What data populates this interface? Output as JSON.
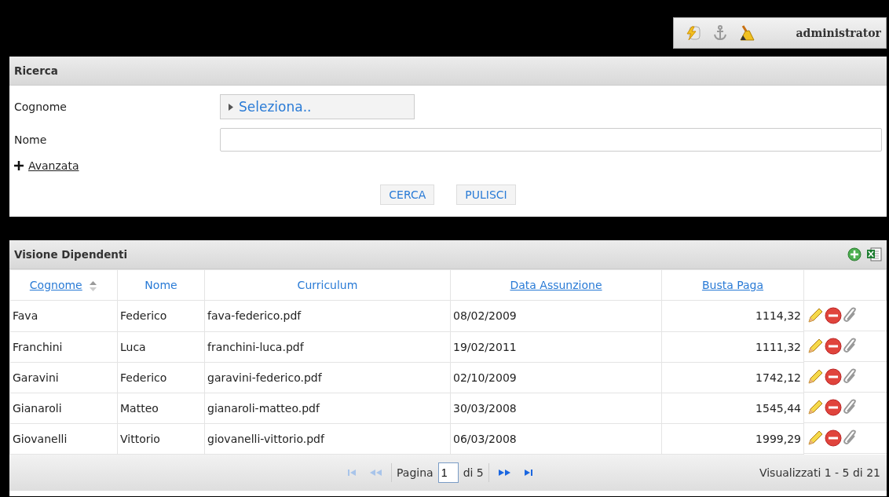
{
  "user_bar": {
    "user": "administrator"
  },
  "search_panel": {
    "title": "Ricerca",
    "fields": [
      {
        "label": "Cognome",
        "kind": "select",
        "value": "Seleziona.."
      },
      {
        "label": "Nome",
        "kind": "text"
      }
    ],
    "advanced_link": "Avanzata",
    "buttons": [
      "CERCA",
      "PULISCI"
    ]
  },
  "grid": {
    "title": "Visione Dipendenti",
    "columns": [
      {
        "label": "Cognome",
        "sortable": true,
        "sorted": true
      },
      {
        "label": "Nome",
        "sortable": false,
        "sorted": false
      },
      {
        "label": "Curriculum",
        "sortable": false,
        "sorted": false
      },
      {
        "label": "Data Assunzione",
        "sortable": true,
        "sorted": false
      },
      {
        "label": "Busta Paga",
        "sortable": true,
        "sorted": false
      }
    ],
    "rows": [
      [
        "Fava",
        "Federico",
        "fava-federico.pdf",
        "08/02/2009",
        "1114,32"
      ],
      [
        "Franchini",
        "Luca",
        "franchini-luca.pdf",
        "19/02/2011",
        "1111,32"
      ],
      [
        "Garavini",
        "Federico",
        "garavini-federico.pdf",
        "02/10/2009",
        "1742,12"
      ],
      [
        "Gianaroli",
        "Matteo",
        "gianaroli-matteo.pdf",
        "30/03/2008",
        "1545,44"
      ],
      [
        "Giovanelli",
        "Vittorio",
        "giovanelli-vittorio.pdf",
        "06/03/2008",
        "1999,29"
      ]
    ],
    "pager": {
      "page_label": "Pagina",
      "page": "1",
      "of_label": "di 5",
      "first_disabled": true,
      "last_disabled": false,
      "summary": "Visualizzati 1 - 5 di 21"
    }
  }
}
